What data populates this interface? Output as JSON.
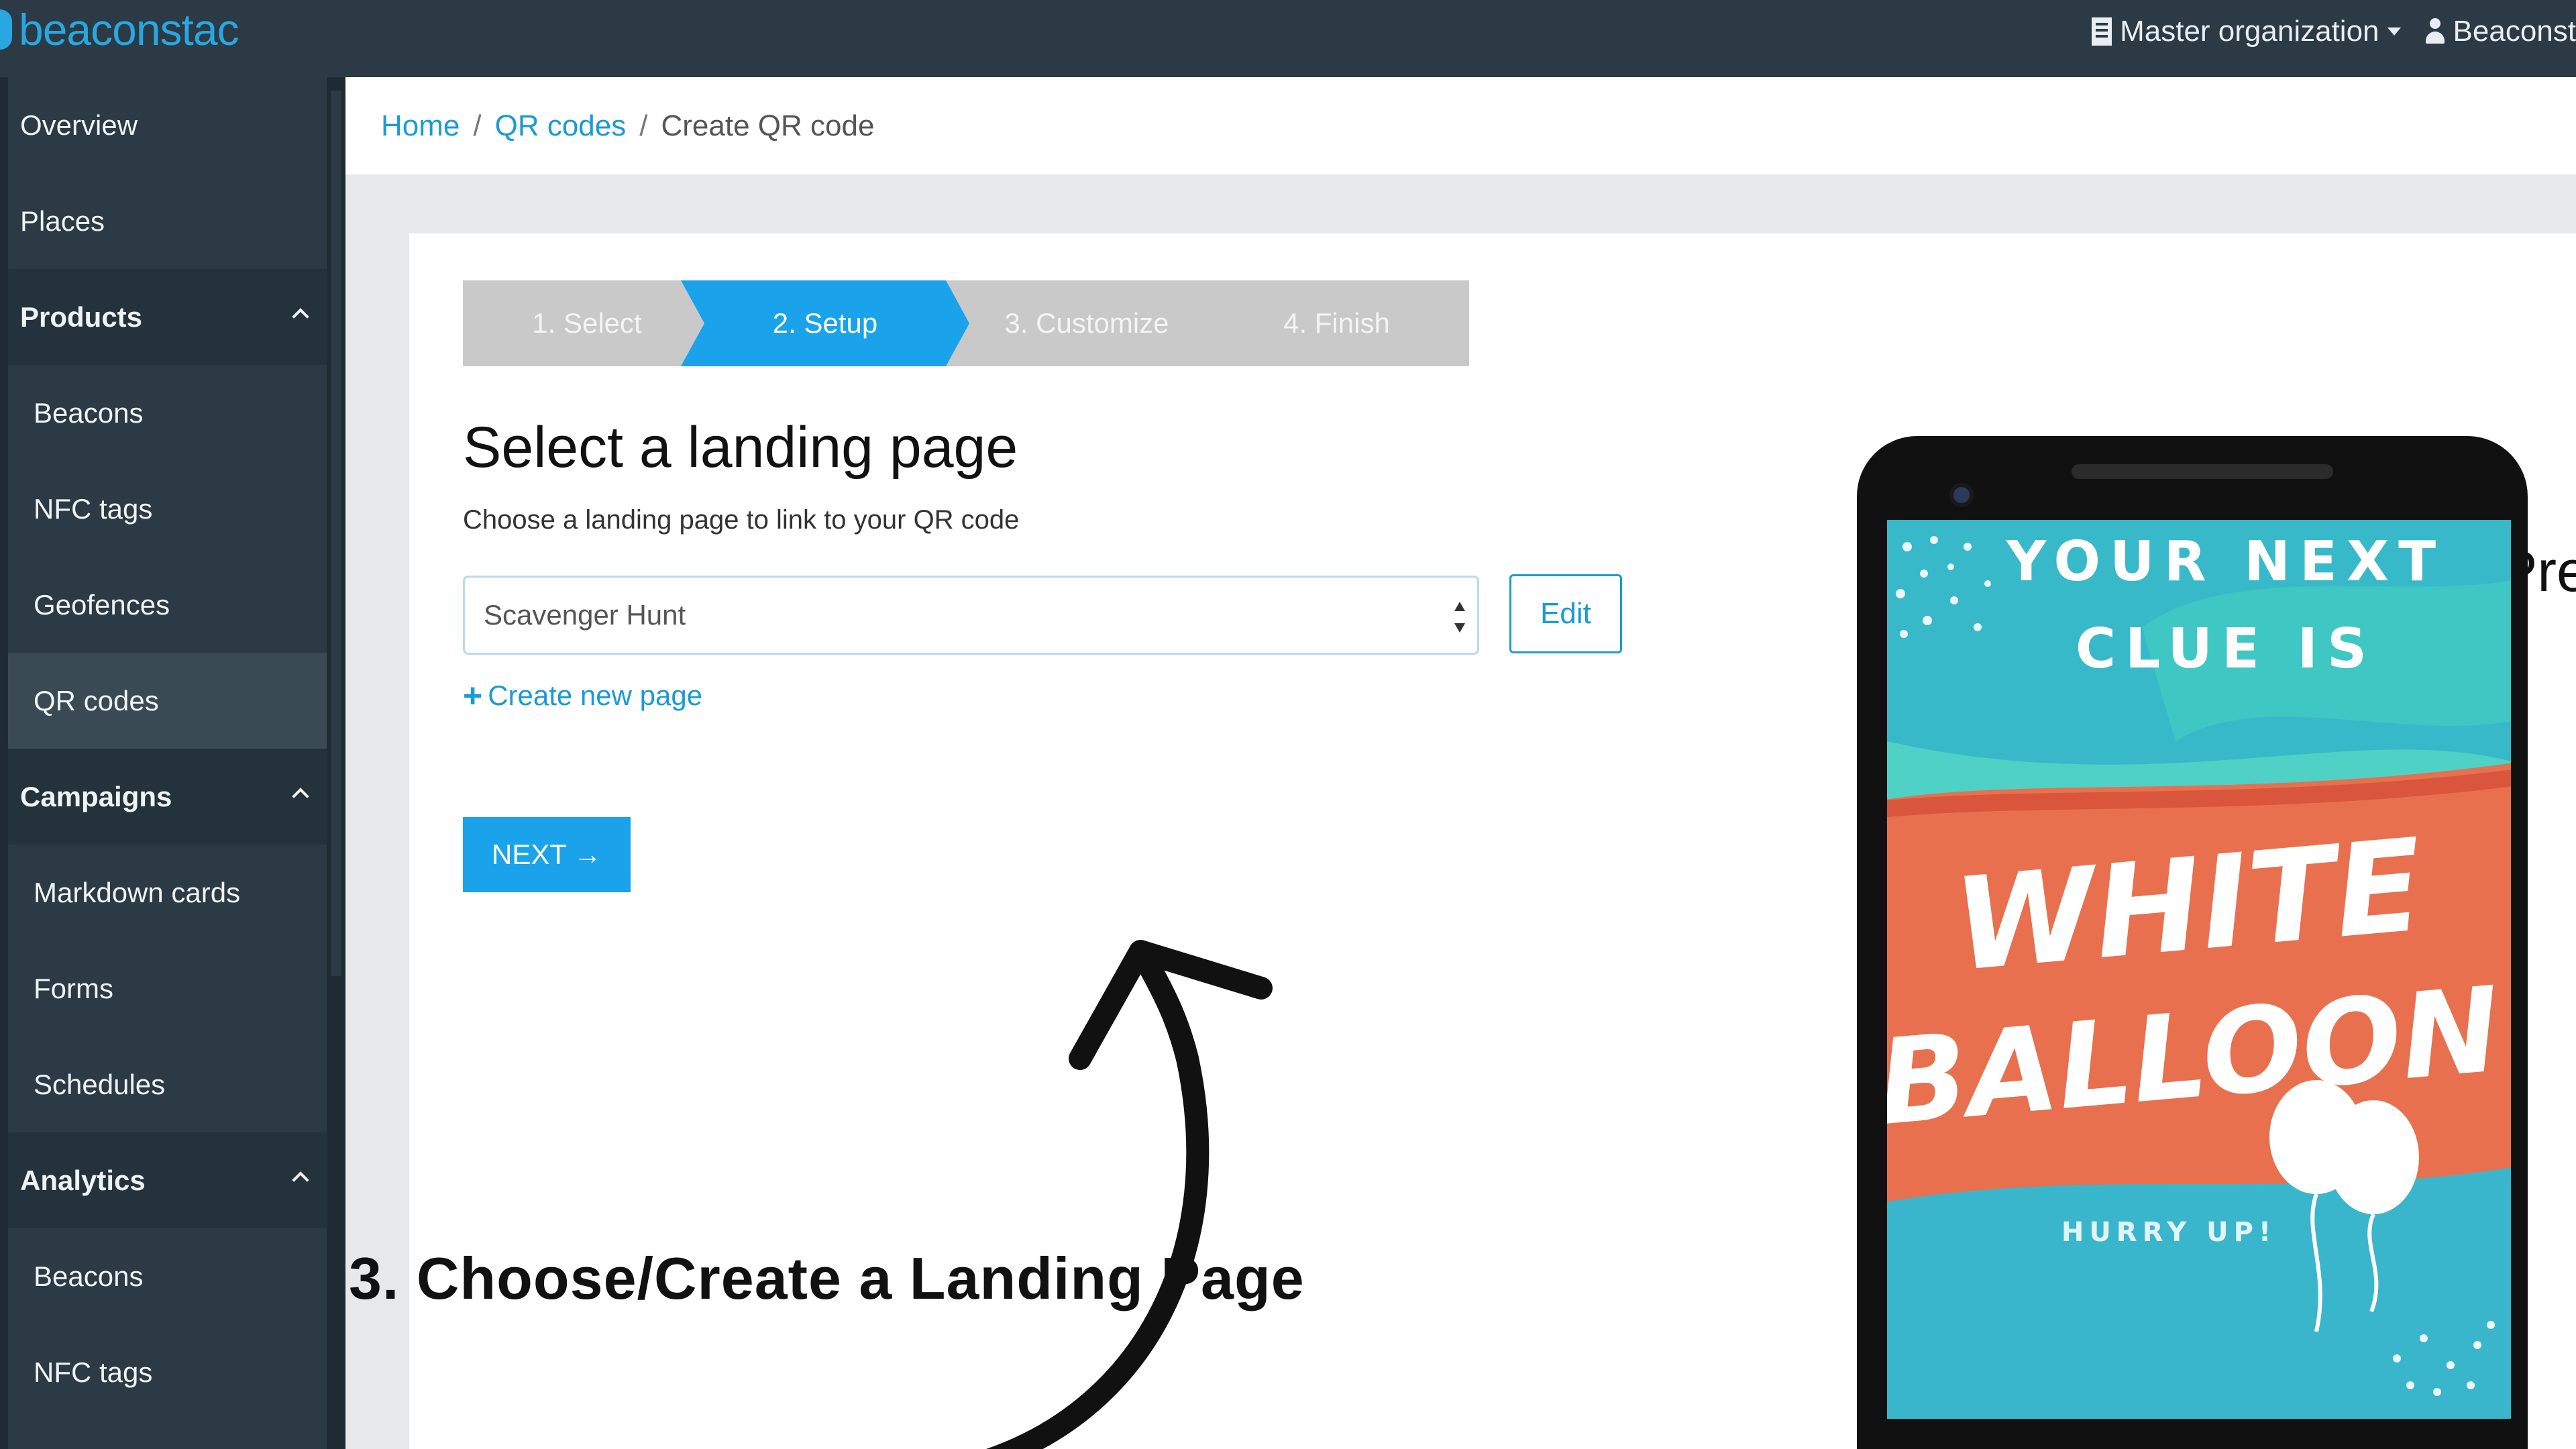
{
  "app": {
    "logo": "beaconstac",
    "org_label": "Master organization",
    "user_label": "Beaconst"
  },
  "sidebar": {
    "items": [
      {
        "label": "Overview",
        "kind": "top"
      },
      {
        "label": "Places",
        "kind": "top"
      },
      {
        "label": "Products",
        "kind": "section"
      },
      {
        "label": "Beacons",
        "kind": "sub"
      },
      {
        "label": "NFC tags",
        "kind": "sub"
      },
      {
        "label": "Geofences",
        "kind": "sub"
      },
      {
        "label": "QR codes",
        "kind": "sub",
        "active": true
      },
      {
        "label": "Campaigns",
        "kind": "section"
      },
      {
        "label": "Markdown cards",
        "kind": "sub"
      },
      {
        "label": "Forms",
        "kind": "sub"
      },
      {
        "label": "Schedules",
        "kind": "sub"
      },
      {
        "label": "Analytics",
        "kind": "section"
      },
      {
        "label": "Beacons",
        "kind": "sub"
      },
      {
        "label": "NFC tags",
        "kind": "sub"
      }
    ]
  },
  "breadcrumb": {
    "home": "Home",
    "sep": "/",
    "qr_codes": "QR codes",
    "current": "Create QR code"
  },
  "stepper": {
    "steps": [
      "1. Select",
      "2. Setup",
      "3. Customize",
      "4. Finish"
    ],
    "active_step": 2
  },
  "form": {
    "title": "Select a landing page",
    "subtitle": "Choose a landing page to link to your QR code",
    "selected_page": "Scavenger Hunt",
    "edit_label": "Edit",
    "create_plus": "+",
    "create_label": "Create new page",
    "next_label": "NEXT",
    "next_arrow": "→"
  },
  "annotation": {
    "text": "3. Choose/Create a Landing Page"
  },
  "preview": {
    "title": "Preview",
    "line1": "YOUR NEXT",
    "line2": "CLUE IS",
    "word1": "WHITE",
    "word2": "BALLOON",
    "footer": "HURRY UP!"
  },
  "colors": {
    "accent": "#1aa3ea",
    "sidebar_bg": "#2b3a44",
    "teal": "#4fd1c5",
    "coral": "#e8704e"
  }
}
